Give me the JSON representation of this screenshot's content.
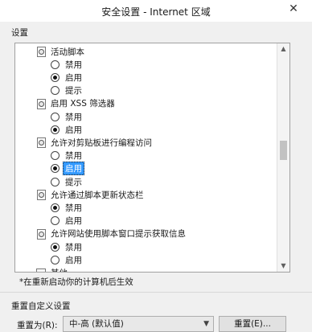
{
  "window": {
    "title": "安全设置 - Internet 区域",
    "close_glyph": "✕"
  },
  "settings_label": "设置",
  "tree": [
    {
      "type": "category",
      "label": "活动脚本"
    },
    {
      "type": "option",
      "label": "禁用",
      "checked": false
    },
    {
      "type": "option",
      "label": "启用",
      "checked": true
    },
    {
      "type": "option",
      "label": "提示",
      "checked": false
    },
    {
      "type": "category",
      "label": "启用 XSS 筛选器"
    },
    {
      "type": "option",
      "label": "禁用",
      "checked": false
    },
    {
      "type": "option",
      "label": "启用",
      "checked": true
    },
    {
      "type": "category",
      "label": "允许对剪贴板进行编程访问"
    },
    {
      "type": "option",
      "label": "禁用",
      "checked": false
    },
    {
      "type": "option",
      "label": "启用",
      "checked": true,
      "selected": true
    },
    {
      "type": "option",
      "label": "提示",
      "checked": false
    },
    {
      "type": "category",
      "label": "允许通过脚本更新状态栏"
    },
    {
      "type": "option",
      "label": "禁用",
      "checked": true
    },
    {
      "type": "option",
      "label": "启用",
      "checked": false
    },
    {
      "type": "category",
      "label": "允许网站使用脚本窗口提示获取信息"
    },
    {
      "type": "option",
      "label": "禁用",
      "checked": true
    },
    {
      "type": "option",
      "label": "启用",
      "checked": false
    },
    {
      "type": "folder",
      "label": "其他"
    }
  ],
  "restart_note": "*在重新启动你的计算机后生效",
  "reset_section": {
    "title": "重置自定义设置",
    "label": "重置为(R):",
    "selected_level": "中-高 (默认值)",
    "button_label": "重置(E)..."
  }
}
